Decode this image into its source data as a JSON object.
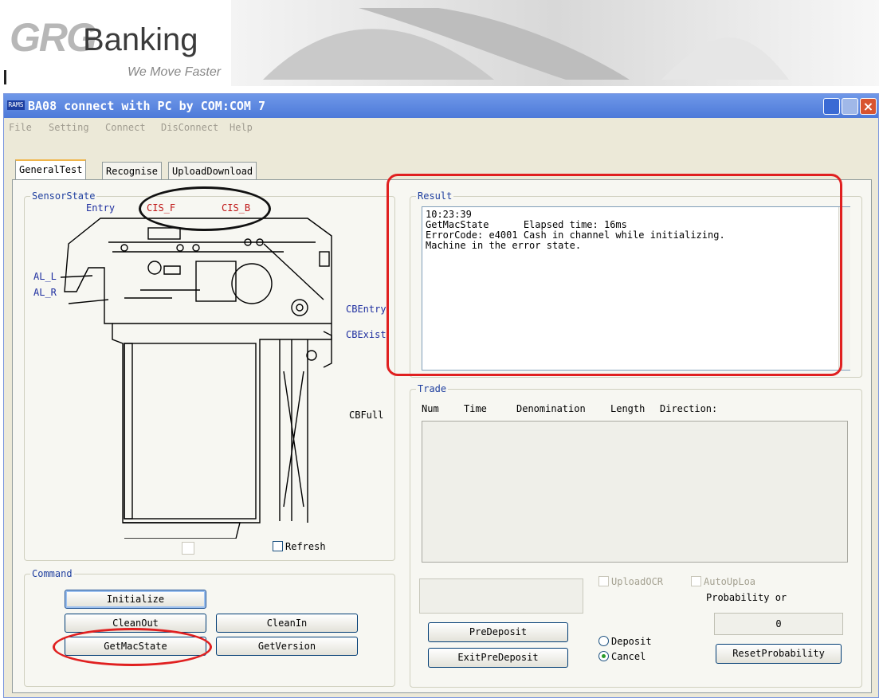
{
  "banner": {
    "logo_grg": "GRG",
    "logo_banking": "Banking",
    "tagline": "We Move Faster"
  },
  "window": {
    "app_icon": "RAMS",
    "title": "BA08 connect with PC by COM:COM 7",
    "menu": [
      "File",
      "Setting",
      "Connect",
      "DisConnect",
      "Help"
    ],
    "tabs": [
      "GeneralTest",
      "Recognise",
      "UploadDownload"
    ]
  },
  "sensor_state": {
    "label": "SensorState",
    "sensors": {
      "entry": "Entry",
      "cis_f": "CIS_F",
      "cis_b": "CIS_B",
      "al_l": "AL_L",
      "al_r": "AL_R",
      "cb_entry": "CBEntry",
      "cb_exist": "CBExist",
      "cb_full": "CBFull"
    },
    "refresh_label": "Refresh"
  },
  "command": {
    "label": "Command",
    "buttons": {
      "initialize": "Initialize",
      "clean_out": "CleanOut",
      "clean_in": "CleanIn",
      "get_mac_state": "GetMacState",
      "get_version": "GetVersion"
    }
  },
  "result": {
    "label": "Result",
    "lines": [
      "10:23:39",
      "GetMacState      Elapsed time: 16ms",
      "ErrorCode: e4001 Cash in channel while initializing.",
      "Machine in the error state."
    ]
  },
  "trade": {
    "label": "Trade",
    "columns": [
      "Num",
      "Time",
      "Denomination",
      "Length",
      "Direction:"
    ]
  },
  "bottom": {
    "upload_ocr": "UploadOCR",
    "auto_upload": "AutoUpLoa",
    "probability_label": "Probability or",
    "probability_value": "0",
    "pre_deposit": "PreDeposit",
    "exit_pre_deposit": "ExitPreDeposit",
    "deposit": "Deposit",
    "cancel": "Cancel",
    "reset_probability": "ResetProbability"
  },
  "colors": {
    "annotation": "#e02020",
    "sensor_blue": "#1f2fa0",
    "sensor_red": "#c01818"
  }
}
